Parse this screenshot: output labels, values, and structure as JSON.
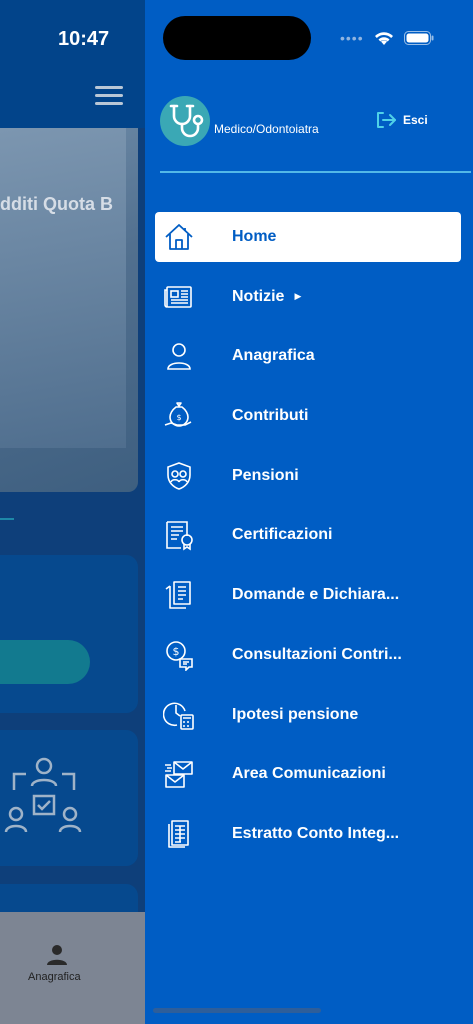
{
  "status_bar": {
    "time": "10:47"
  },
  "background": {
    "caption": "dditi Quota B",
    "tab_label": "Anagrafica"
  },
  "drawer": {
    "role": "Medico/Odontoiatra",
    "logout_label": "Esci",
    "menu": [
      {
        "label": "Home",
        "icon": "home-icon",
        "active": true
      },
      {
        "label": "Notizie",
        "icon": "newspaper-icon",
        "has_submenu": true
      },
      {
        "label": "Anagrafica",
        "icon": "user-icon"
      },
      {
        "label": "Contributi",
        "icon": "money-bag-hand-icon"
      },
      {
        "label": "Pensioni",
        "icon": "shield-people-icon"
      },
      {
        "label": "Certificazioni",
        "icon": "certificate-icon"
      },
      {
        "label": "Domande e Dichiara...",
        "icon": "documents-icon"
      },
      {
        "label": "Consultazioni Contri...",
        "icon": "coin-chat-icon"
      },
      {
        "label": "Ipotesi pensione",
        "icon": "clock-calculator-icon"
      },
      {
        "label": "Area Comunicazioni",
        "icon": "envelopes-icon"
      },
      {
        "label": "Estratto Conto Integ...",
        "icon": "statement-icon"
      }
    ]
  },
  "colors": {
    "drawer_bg": "#005dc4",
    "accent_line": "#52b8e8",
    "active_text": "#005dc4"
  }
}
